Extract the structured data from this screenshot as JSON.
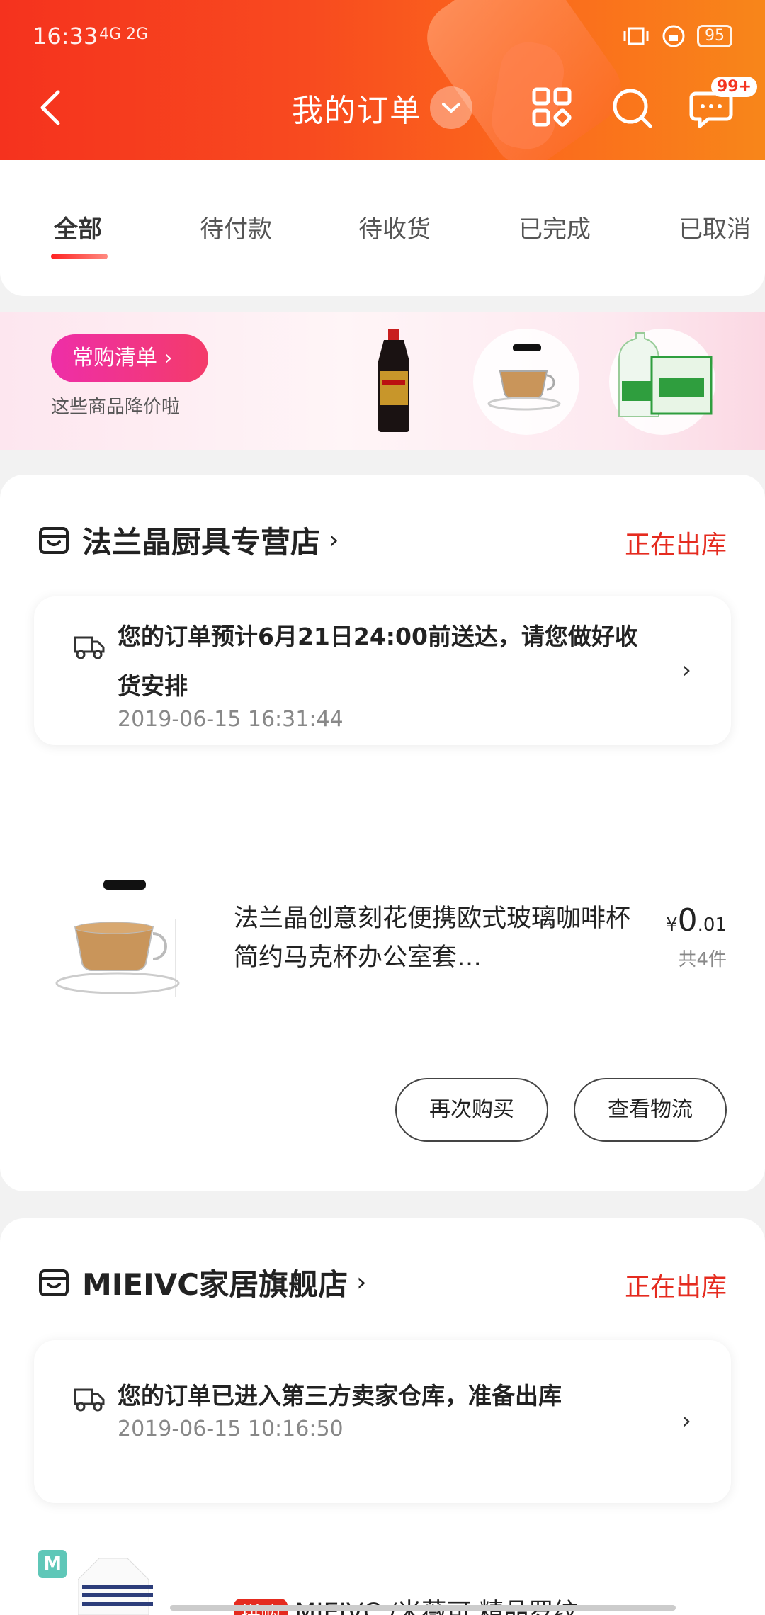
{
  "status_bar": {
    "time": "16:33",
    "signal": "4G 2G",
    "battery": "95"
  },
  "header": {
    "title": "我的订单",
    "message_badge": "99+"
  },
  "tabs": [
    "全部",
    "待付款",
    "待收货",
    "已完成",
    "已取消"
  ],
  "banner": {
    "button": "常购清单 ›",
    "subtitle": "这些商品降价啦"
  },
  "orders": [
    {
      "shop": "法兰晶厨具专营店",
      "status": "正在出库",
      "shipping_message": "您的订单预计6月21日24:00前送达，请您做好收货安排",
      "shipping_time": "2019-06-15 16:31:44",
      "product_title": "法兰晶创意刻花便携欧式玻璃咖啡杯简约马克杯办公室套…",
      "price_symbol": "¥",
      "price_int": "0",
      "price_dec": ".01",
      "qty": "共4件",
      "btn_rebuy": "再次购买",
      "btn_logistics": "查看物流"
    },
    {
      "shop": "MIEIVC家居旗舰店",
      "status": "正在出库",
      "shipping_message": "您的订单已进入第三方卖家仓库，准备出库",
      "shipping_time": "2019-06-15 10:16:50",
      "product_tag": "拼购",
      "product_title": "MIEIVC /米薇可 精品罗纹"
    }
  ],
  "colors": {
    "header_start": "#f5321e",
    "header_end": "#f8861a",
    "accent_red": "#e52b1f"
  },
  "icons": [
    "back-icon",
    "chevron-down-icon",
    "grid-icon",
    "search-icon",
    "message-icon",
    "shop-icon",
    "truck-icon"
  ]
}
